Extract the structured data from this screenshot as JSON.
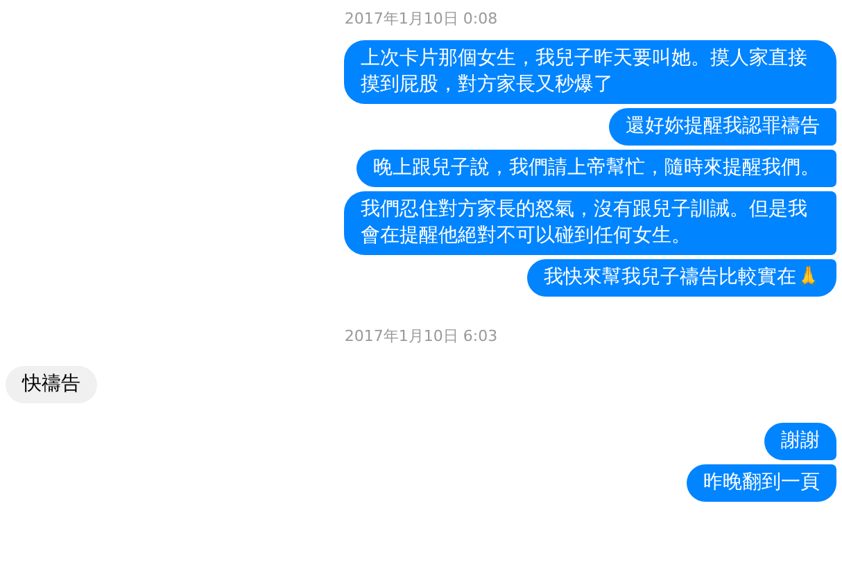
{
  "messages": [
    {
      "kind": "timestamp",
      "text": "2017年1月10日 0:08"
    },
    {
      "kind": "sent",
      "text": "上次卡片那個女生，我兒子昨天要叫她。摸人家直接摸到屁股，對方家長又秒爆了"
    },
    {
      "kind": "sent",
      "text": "還好妳提醒我認罪禱告"
    },
    {
      "kind": "sent",
      "text": "晚上跟兒子說，我們請上帝幫忙，隨時來提醒我們。"
    },
    {
      "kind": "sent",
      "text": "我們忍住對方家長的怒氣，沒有跟兒子訓誡。但是我會在提醒他絕對不可以碰到任何女生。"
    },
    {
      "kind": "sent",
      "text": "我快來幫我兒子禱告比較實在🙏"
    },
    {
      "kind": "timestamp",
      "text": "2017年1月10日 6:03"
    },
    {
      "kind": "received",
      "text": "快禱告"
    },
    {
      "kind": "sent",
      "text": "謝謝"
    },
    {
      "kind": "sent",
      "text": "昨晚翻到一頁"
    }
  ]
}
